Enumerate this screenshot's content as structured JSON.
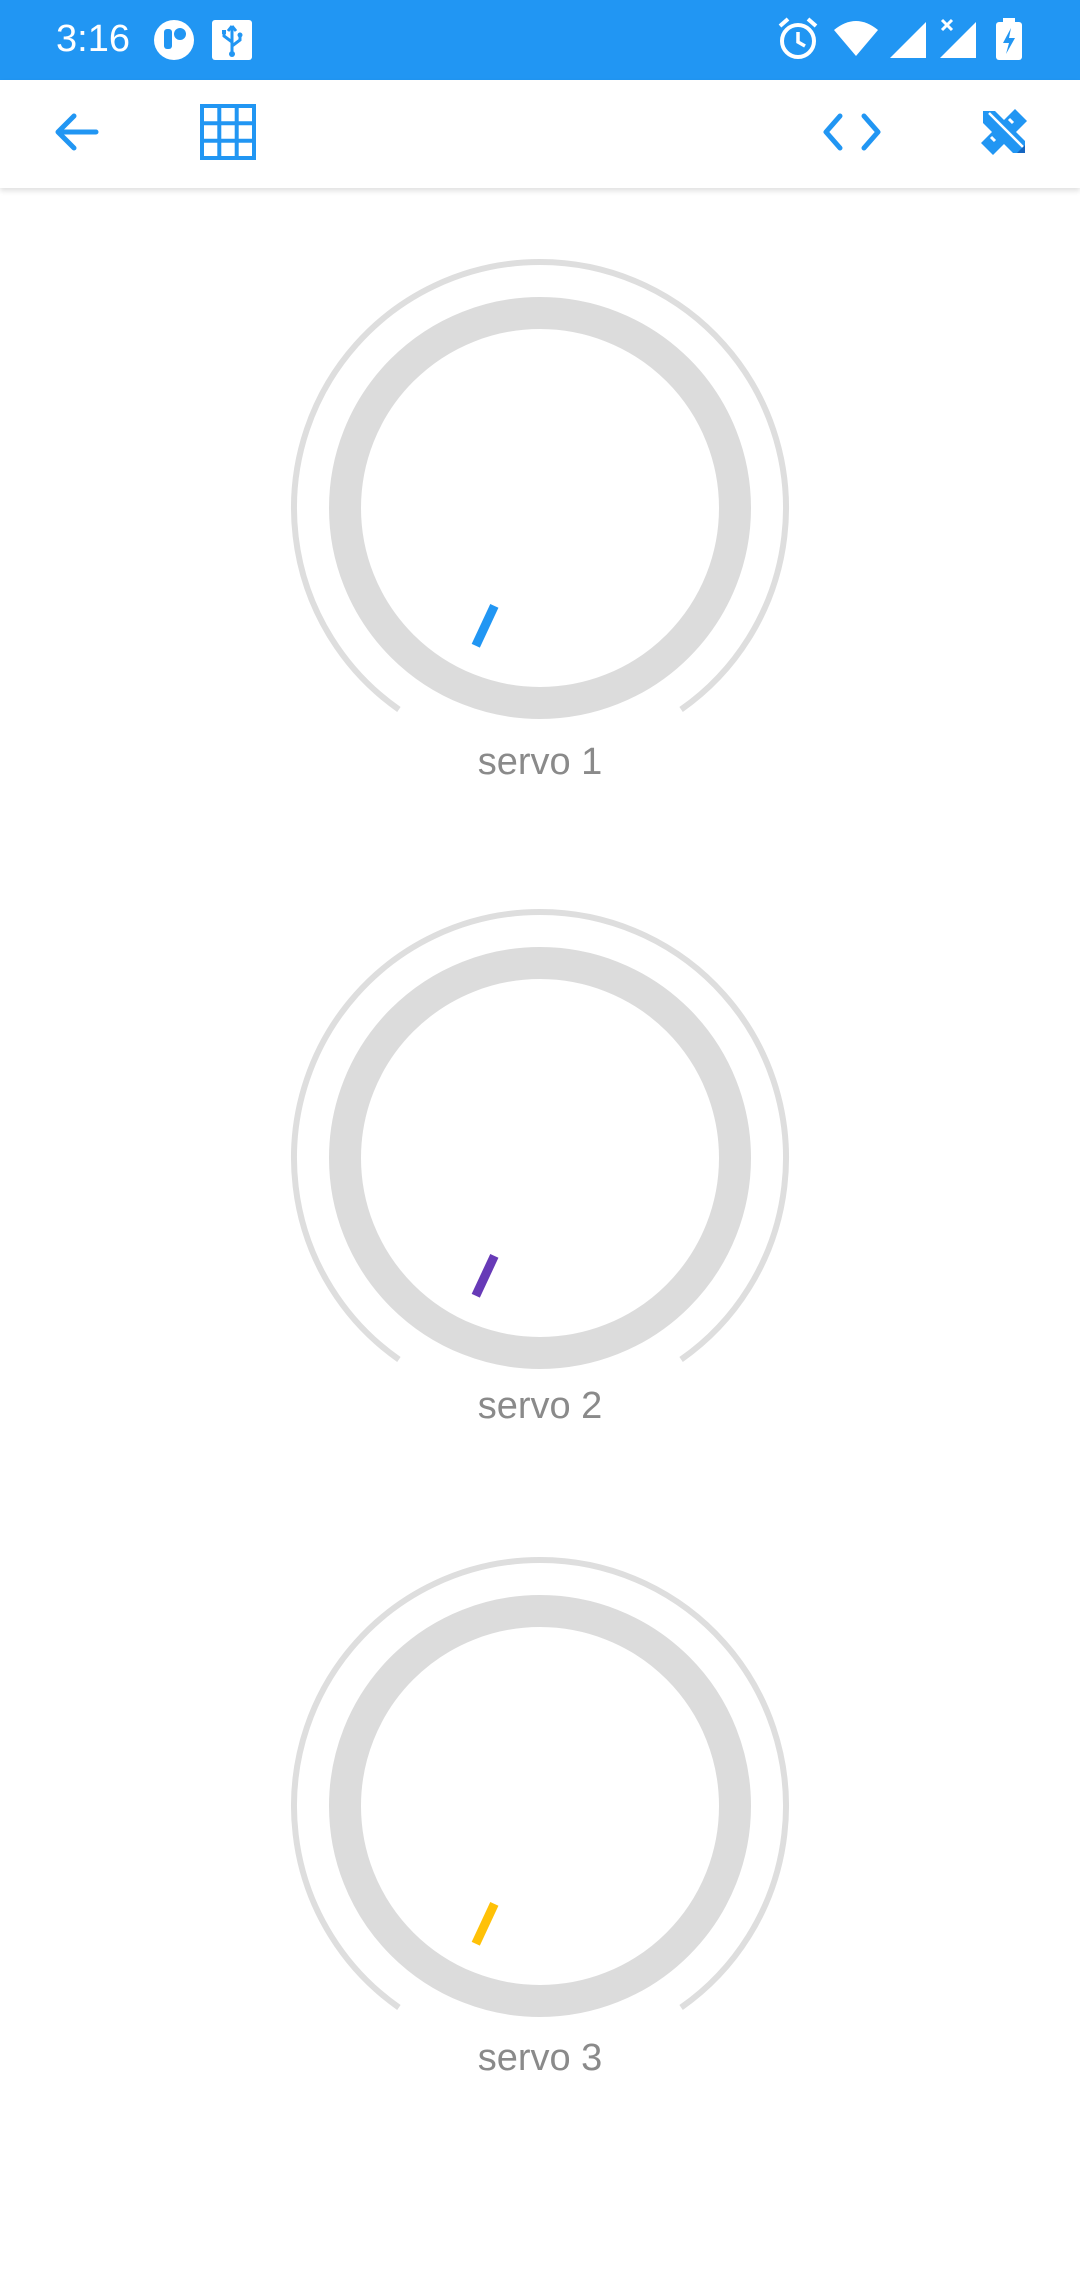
{
  "status_bar": {
    "time": "3:16",
    "background": "#2196F3",
    "left_icons": [
      "notification-app-icon",
      "usb-icon"
    ],
    "right_icons": [
      "alarm-icon",
      "wifi-icon",
      "signal-icon",
      "signal-no-data-icon",
      "battery-charging-icon"
    ]
  },
  "toolbar": {
    "accent": "#2196F3",
    "buttons": [
      {
        "name": "back",
        "icon": "arrow-left-icon"
      },
      {
        "name": "grid",
        "icon": "grid-icon"
      },
      {
        "name": "code",
        "icon": "code-icon"
      },
      {
        "name": "edit",
        "icon": "design-tools-icon"
      }
    ]
  },
  "knobs": [
    {
      "label": "servo 1",
      "color": "#2196F3",
      "value_fraction": 0.08
    },
    {
      "label": "servo 2",
      "color": "#673AB7",
      "value_fraction": 0.08
    },
    {
      "label": "servo 3",
      "color": "#FFC107",
      "value_fraction": 0.08
    }
  ]
}
